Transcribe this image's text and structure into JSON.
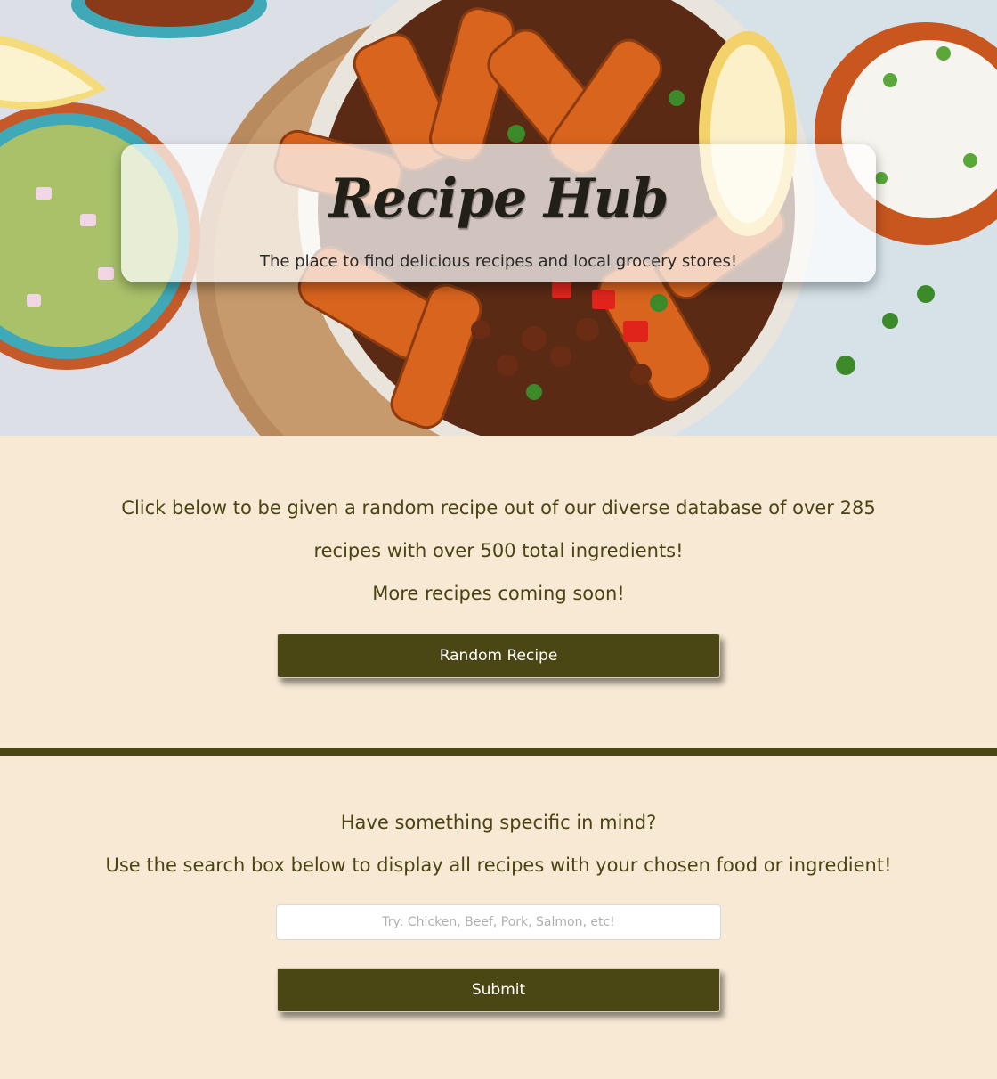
{
  "hero": {
    "title": "Recipe Hub",
    "subtitle": "The place to find delicious recipes and local grocery stores!"
  },
  "random": {
    "line1": "Click below to be given a random recipe out of our diverse database of over 285",
    "line2": "recipes with over 500 total ingredients!",
    "line3": "More recipes coming soon!",
    "button_label": "Random Recipe"
  },
  "search": {
    "heading": "Have something specific in mind?",
    "instructions": "Use the search box below to display all recipes with your chosen food or ingredient!",
    "input_value": "",
    "placeholder": "Try: Chicken, Beef, Pork, Salmon, etc!",
    "submit_label": "Submit"
  },
  "colors": {
    "page_background": "#f7e9d4",
    "accent": "#4a4714",
    "text": "#4a4413"
  }
}
